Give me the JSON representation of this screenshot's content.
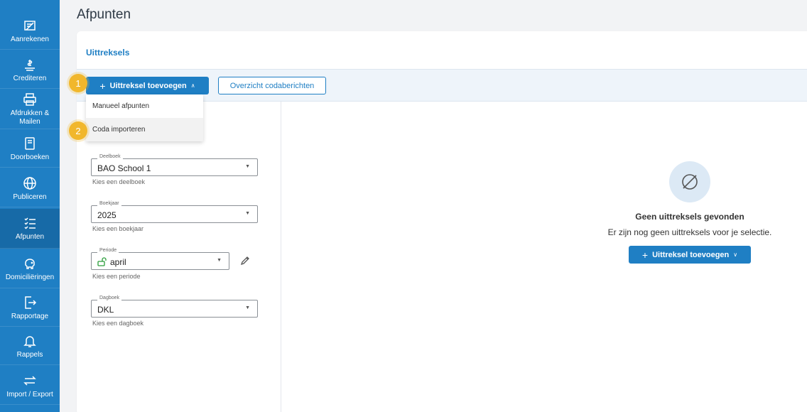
{
  "sidebar": {
    "items": [
      {
        "label": "Aanrekenen",
        "icon": "invoice-icon"
      },
      {
        "label": "Crediteren",
        "icon": "hand-money-icon"
      },
      {
        "label": "Afdrukken & Mailen",
        "icon": "printer-icon"
      },
      {
        "label": "Doorboeken",
        "icon": "book-icon"
      },
      {
        "label": "Publiceren",
        "icon": "globe-icon"
      },
      {
        "label": "Afpunten",
        "icon": "checklist-icon",
        "active": true
      },
      {
        "label": "Domiciliëringen",
        "icon": "piggy-bank-icon"
      },
      {
        "label": "Rapportage",
        "icon": "document-export-icon"
      },
      {
        "label": "Rappels",
        "icon": "bell-icon"
      },
      {
        "label": "Import / Export",
        "icon": "swap-arrows-icon"
      }
    ]
  },
  "page": {
    "title": "Afpunten"
  },
  "card": {
    "title": "Uittreksels"
  },
  "toolbar": {
    "add_label": "Uittreksel toevoegen",
    "overview_label": "Overzicht codaberichten"
  },
  "dropdown": {
    "items": [
      "Manueel afpunten",
      "Coda importeren"
    ]
  },
  "badges": {
    "one": "1",
    "two": "2"
  },
  "form": {
    "deelboek": {
      "label": "Deelboek",
      "value": "BAO School 1",
      "hint": "Kies een deelboek"
    },
    "boekjaar": {
      "label": "Boekjaar",
      "value": "2025",
      "hint": "Kies een boekjaar"
    },
    "periode": {
      "label": "Periode",
      "value": "april",
      "hint": "Kies een periode"
    },
    "dagboek": {
      "label": "Dagboek",
      "value": "DKL",
      "hint": "Kies een dagboek"
    }
  },
  "empty_state": {
    "title": "Geen uittreksels gevonden",
    "subtitle": "Er zijn nog geen uittreksels voor je selectie.",
    "button_label": "Uittreksel toevoegen"
  },
  "colors": {
    "primary": "#1f7fc4",
    "badge": "#f1b72c",
    "sidebar_active": "#176aa7"
  }
}
